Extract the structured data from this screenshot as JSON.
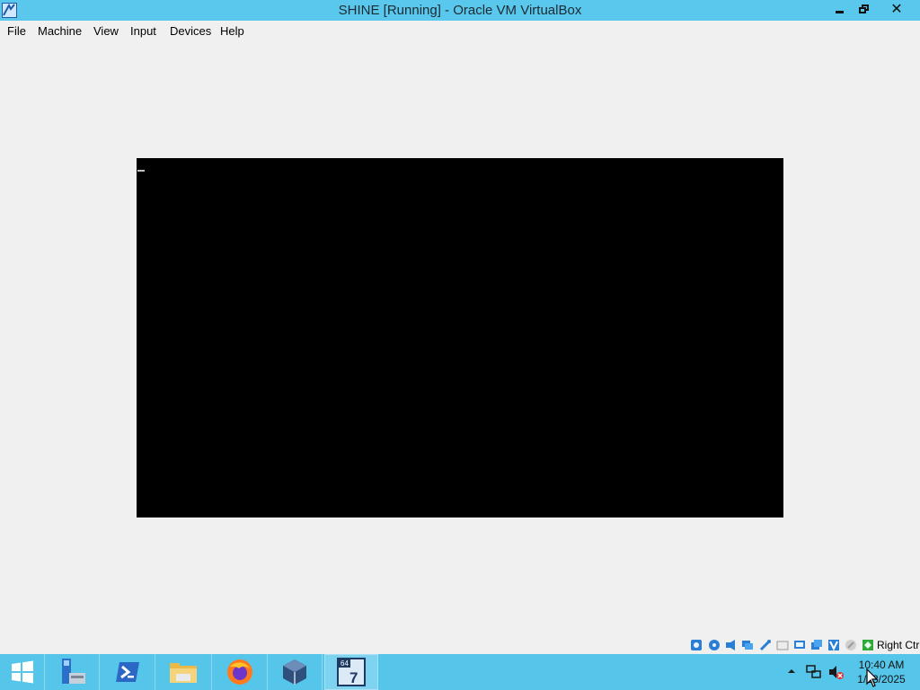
{
  "window": {
    "title": "SHINE [Running] - Oracle VM VirtualBox",
    "app_icon": "virtualbox-vm-icon",
    "controls": [
      "minimize-icon",
      "restore-icon",
      "close-icon"
    ]
  },
  "menu": {
    "items": [
      {
        "label": "File"
      },
      {
        "label": "Machine"
      },
      {
        "label": "View"
      },
      {
        "label": "Input"
      },
      {
        "label": "Devices"
      },
      {
        "label": "Help"
      }
    ]
  },
  "vm_screen": {
    "background": "#000000",
    "cursor_glyph": "text-cursor"
  },
  "statusbar": {
    "icons": [
      "hard-disk-icon",
      "optical-drive-icon",
      "audio-icon",
      "network-icon",
      "usb-icon",
      "shared-folders-icon",
      "display-icon",
      "video-capture-icon",
      "vt-x-icon",
      "mouse-integration-icon",
      "keyboard-capture-icon"
    ],
    "host_key_label": "Right Ctrl"
  },
  "taskbar": {
    "apps": [
      "windows-start-icon",
      "server-manager-icon",
      "powershell-icon",
      "file-explorer-icon",
      "firefox-icon",
      "virtualbox-icon",
      "vm-window-icon"
    ],
    "active_app_badge": "64",
    "active_app_number": "7",
    "tray_icons": [
      "show-hidden-icons-arrow-icon",
      "network-icon",
      "volume-muted-icon"
    ],
    "clock_time": "10:40 AM",
    "clock_date": "1/13/2025"
  },
  "colors": {
    "titlebar": "#5ac8ec",
    "taskbar": "#55c5ea",
    "window_bg": "#f0f0f0",
    "vm_bg": "#000000"
  }
}
